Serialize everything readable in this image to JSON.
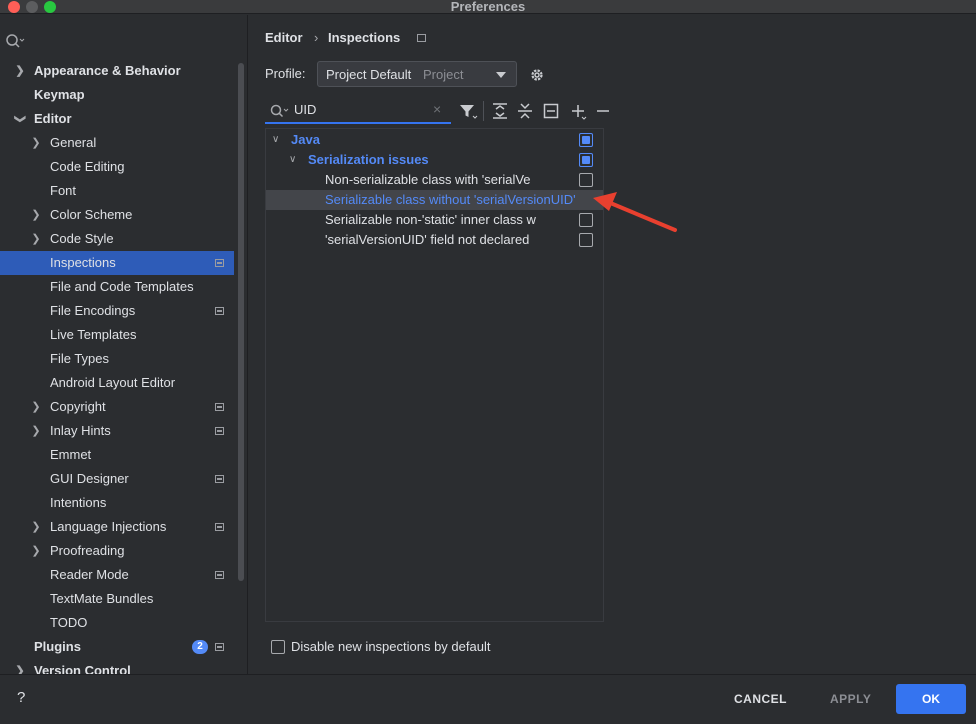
{
  "window": {
    "title": "Preferences"
  },
  "sidebar": {
    "search_placeholder": "",
    "items": [
      {
        "label": "Appearance & Behavior",
        "bold": true
      },
      {
        "label": "Keymap",
        "bold": true
      },
      {
        "label": "Editor",
        "bold": true
      },
      {
        "label": "General"
      },
      {
        "label": "Code Editing"
      },
      {
        "label": "Font"
      },
      {
        "label": "Color Scheme"
      },
      {
        "label": "Code Style"
      },
      {
        "label": "Inspections",
        "selected": true
      },
      {
        "label": "File and Code Templates"
      },
      {
        "label": "File Encodings"
      },
      {
        "label": "Live Templates"
      },
      {
        "label": "File Types"
      },
      {
        "label": "Android Layout Editor"
      },
      {
        "label": "Copyright"
      },
      {
        "label": "Inlay Hints"
      },
      {
        "label": "Emmet"
      },
      {
        "label": "GUI Designer"
      },
      {
        "label": "Intentions"
      },
      {
        "label": "Language Injections"
      },
      {
        "label": "Proofreading"
      },
      {
        "label": "Reader Mode"
      },
      {
        "label": "TextMate Bundles"
      },
      {
        "label": "TODO"
      },
      {
        "label": "Plugins",
        "bold": true,
        "badge": "2"
      },
      {
        "label": "Version Control",
        "bold": true
      }
    ]
  },
  "breadcrumb": {
    "parent": "Editor",
    "separator": "›",
    "current": "Inspections"
  },
  "profile": {
    "label": "Profile:",
    "value": "Project Default",
    "scope": "Project"
  },
  "filter": {
    "value": "UID"
  },
  "tree": {
    "rows": [
      {
        "label": "Java",
        "checked": true
      },
      {
        "label": "Serialization issues",
        "checked": true
      },
      {
        "label": "Non-serializable class with 'serialVe",
        "checked": false
      },
      {
        "label": "Serializable class without 'serialVersionUID'",
        "checked": false
      },
      {
        "label": "Serializable non-'static' inner class w",
        "checked": false
      },
      {
        "label": "'serialVersionUID' field not declared",
        "checked": false
      }
    ]
  },
  "options": {
    "disable_new_label": "Disable new inspections by default"
  },
  "footer": {
    "help": "?",
    "cancel": "CANCEL",
    "apply": "APPLY",
    "ok": "OK"
  },
  "colors": {
    "accent": "#3574f0",
    "highlight_text": "#548af7",
    "annotation_arrow": "#e8402f"
  }
}
